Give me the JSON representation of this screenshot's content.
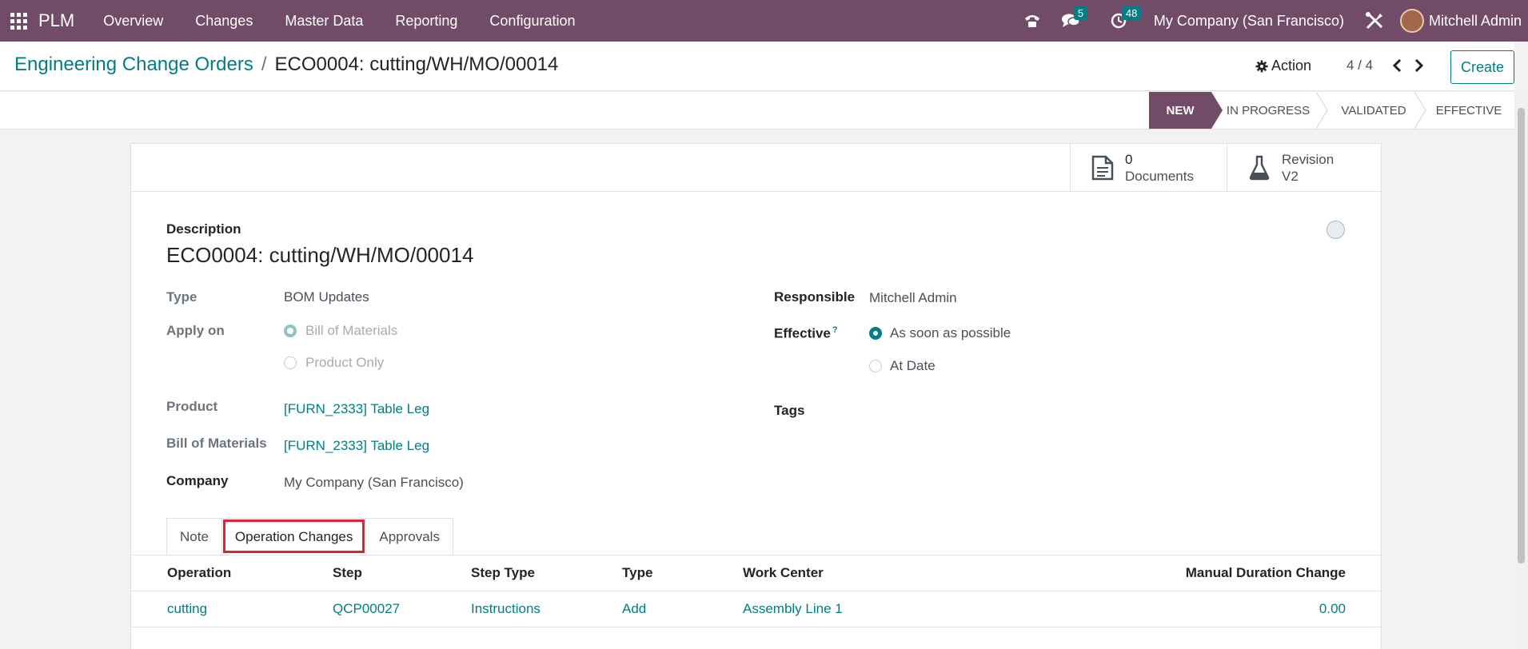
{
  "navbar": {
    "app_name": "PLM",
    "menu": [
      "Overview",
      "Changes",
      "Master Data",
      "Reporting",
      "Configuration"
    ],
    "messages_count": "5",
    "activities_count": "48",
    "company": "My Company (San Francisco)",
    "user": "Mitchell Admin",
    "brand_color": "#714b67"
  },
  "control": {
    "breadcrumb_parent": "Engineering Change Orders",
    "breadcrumb_separator": "/",
    "breadcrumb_current": "ECO0004: cutting/WH/MO/00014",
    "action_label": "Action",
    "pager": "4 / 4",
    "create_label": "Create"
  },
  "statusbar": {
    "stages": [
      "NEW",
      "IN PROGRESS",
      "VALIDATED",
      "EFFECTIVE"
    ],
    "current": "NEW"
  },
  "smart_buttons": {
    "documents_value": "0",
    "documents_label": "Documents",
    "revision_label": "Revision",
    "revision_value": "V2"
  },
  "form": {
    "description_label": "Description",
    "title": "ECO0004: cutting/WH/MO/00014",
    "type_label": "Type",
    "type_value": "BOM Updates",
    "apply_on_label": "Apply on",
    "apply_on_options": [
      "Bill of Materials",
      "Product Only"
    ],
    "apply_on_selected": "Bill of Materials",
    "product_label": "Product",
    "product_value": "[FURN_2333] Table Leg",
    "bom_label": "Bill of Materials",
    "bom_value": "[FURN_2333] Table Leg",
    "company_label": "Company",
    "company_value": "My Company (San Francisco)",
    "responsible_label": "Responsible",
    "responsible_value": "Mitchell Admin",
    "effective_label": "Effective",
    "effective_help": "?",
    "effective_options": [
      "As soon as possible",
      "At Date"
    ],
    "effective_selected": "As soon as possible",
    "tags_label": "Tags"
  },
  "tabs": [
    "Note",
    "Operation Changes",
    "Approvals"
  ],
  "active_tab": "Operation Changes",
  "table": {
    "headers": [
      "Operation",
      "Step",
      "Step Type",
      "Type",
      "Work Center",
      "Manual Duration Change"
    ],
    "rows": [
      [
        "cutting",
        "QCP00027",
        "Instructions",
        "Add",
        "Assembly Line 1",
        "0.00"
      ]
    ]
  }
}
